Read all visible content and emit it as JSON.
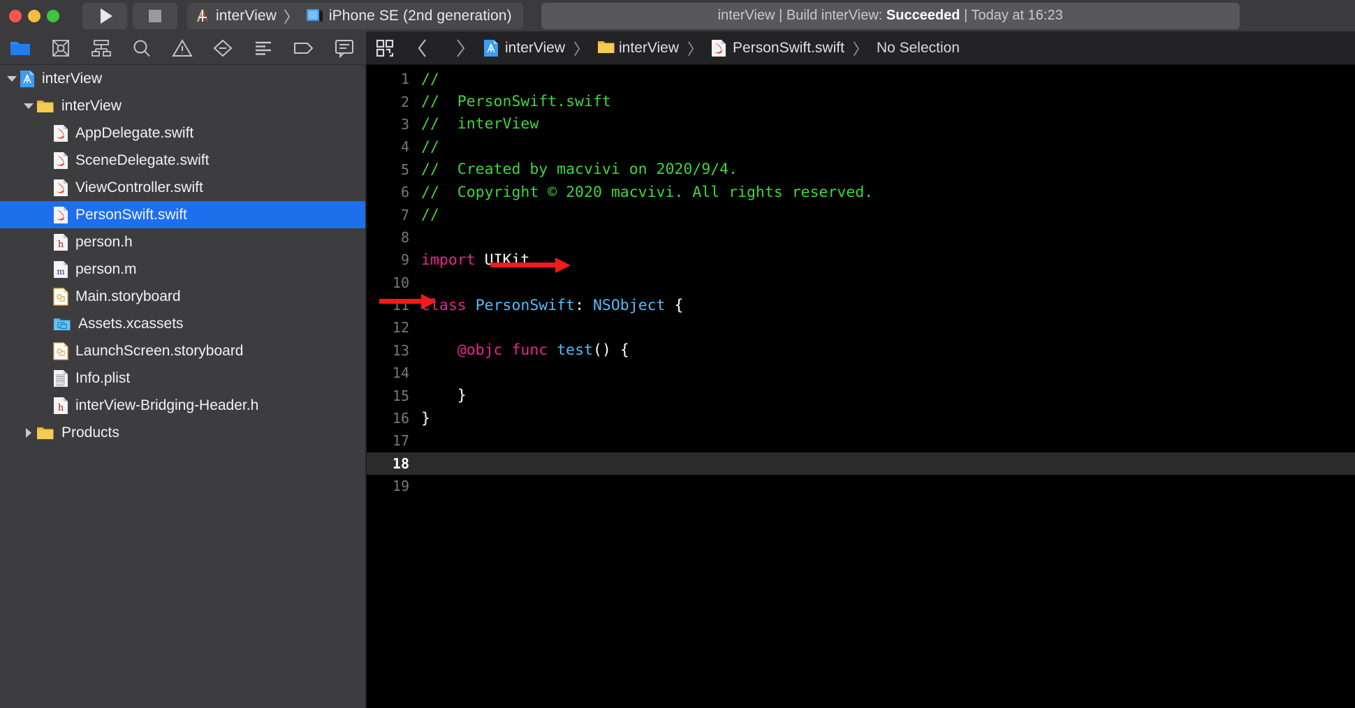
{
  "titlebar": {
    "window_controls": [
      "close",
      "minimize",
      "zoom"
    ],
    "run_button": "run-icon",
    "stop_button": "stop-icon",
    "scheme": {
      "project": "interView",
      "separator": "〉",
      "destination": "iPhone SE (2nd generation)"
    },
    "status": {
      "project": "interView",
      "sep1": "|",
      "action": "Build interView:",
      "result": "Succeeded",
      "sep2": "|",
      "time": "Today at 16:23",
      "full": "interView | Build interView: Succeeded | Today at 16:23"
    }
  },
  "navigator_toolbar": {
    "items": [
      {
        "name": "project-navigator-icon",
        "glyph": "folder",
        "active": true
      },
      {
        "name": "source-control-navigator-icon",
        "glyph": "source-control",
        "active": false
      },
      {
        "name": "symbol-navigator-icon",
        "glyph": "symbol",
        "active": false
      },
      {
        "name": "find-navigator-icon",
        "glyph": "search",
        "active": false
      },
      {
        "name": "issue-navigator-icon",
        "glyph": "warning",
        "active": false
      },
      {
        "name": "test-navigator-icon",
        "glyph": "diamond-minus",
        "active": false
      },
      {
        "name": "debug-navigator-icon",
        "glyph": "debug-lines",
        "active": false
      },
      {
        "name": "breakpoint-navigator-icon",
        "glyph": "tag",
        "active": false
      },
      {
        "name": "report-navigator-icon",
        "glyph": "speech-bubble",
        "active": false
      }
    ]
  },
  "editor_toolbar": {
    "related_items_icon": "grid-squares-icon",
    "back_icon": "‹",
    "forward_icon": "›",
    "breadcrumb": [
      {
        "label": "interView",
        "icon": "xcode-project-icon"
      },
      {
        "label": "interView",
        "icon": "folder-icon"
      },
      {
        "label": "PersonSwift.swift",
        "icon": "swift-file-icon"
      },
      {
        "label": "No Selection",
        "icon": "none"
      }
    ],
    "separator": "〉"
  },
  "navigator": {
    "rows": [
      {
        "label": "interView",
        "icon": "xcode-project-icon",
        "indent": 0,
        "disclosure": "down",
        "selected": false
      },
      {
        "label": "interView",
        "icon": "folder-icon",
        "indent": 1,
        "disclosure": "down",
        "selected": false
      },
      {
        "label": "AppDelegate.swift",
        "icon": "swift-file-icon",
        "indent": 2,
        "disclosure": "none",
        "selected": false
      },
      {
        "label": "SceneDelegate.swift",
        "icon": "swift-file-icon",
        "indent": 2,
        "disclosure": "none",
        "selected": false
      },
      {
        "label": "ViewController.swift",
        "icon": "swift-file-icon",
        "indent": 2,
        "disclosure": "none",
        "selected": false
      },
      {
        "label": "PersonSwift.swift",
        "icon": "swift-file-icon",
        "indent": 2,
        "disclosure": "none",
        "selected": true
      },
      {
        "label": "person.h",
        "icon": "header-file-icon",
        "indent": 2,
        "disclosure": "none",
        "selected": false
      },
      {
        "label": "person.m",
        "icon": "objc-file-icon",
        "indent": 2,
        "disclosure": "none",
        "selected": false
      },
      {
        "label": "Main.storyboard",
        "icon": "storyboard-file-icon",
        "indent": 2,
        "disclosure": "none",
        "selected": false
      },
      {
        "label": "Assets.xcassets",
        "icon": "assets-folder-icon",
        "indent": 2,
        "disclosure": "none",
        "selected": false
      },
      {
        "label": "LaunchScreen.storyboard",
        "icon": "storyboard-file-icon",
        "indent": 2,
        "disclosure": "none",
        "selected": false
      },
      {
        "label": "Info.plist",
        "icon": "plist-file-icon",
        "indent": 2,
        "disclosure": "none",
        "selected": false
      },
      {
        "label": "interView-Bridging-Header.h",
        "icon": "header-file-icon",
        "indent": 2,
        "disclosure": "none",
        "selected": false
      },
      {
        "label": "Products",
        "icon": "folder-icon",
        "indent": 1,
        "disclosure": "right",
        "selected": false
      }
    ]
  },
  "editor": {
    "current_line": 18,
    "total_lines": 19,
    "lines": [
      {
        "n": "1",
        "tokens": [
          {
            "t": "//",
            "c": "comment"
          }
        ]
      },
      {
        "n": "2",
        "tokens": [
          {
            "t": "//  PersonSwift.swift",
            "c": "comment"
          }
        ]
      },
      {
        "n": "3",
        "tokens": [
          {
            "t": "//  interView",
            "c": "comment"
          }
        ]
      },
      {
        "n": "4",
        "tokens": [
          {
            "t": "//",
            "c": "comment"
          }
        ]
      },
      {
        "n": "5",
        "tokens": [
          {
            "t": "//  Created by macvivi on 2020/9/4.",
            "c": "comment"
          }
        ]
      },
      {
        "n": "6",
        "tokens": [
          {
            "t": "//  Copyright © 2020 macvivi. All rights reserved.",
            "c": "comment"
          }
        ]
      },
      {
        "n": "7",
        "tokens": [
          {
            "t": "//",
            "c": "comment"
          }
        ]
      },
      {
        "n": "8",
        "tokens": []
      },
      {
        "n": "9",
        "tokens": [
          {
            "t": "import",
            "c": "kw"
          },
          {
            "t": " ",
            "c": "plain"
          },
          {
            "t": "UIKit",
            "c": "plain"
          }
        ]
      },
      {
        "n": "10",
        "tokens": []
      },
      {
        "n": "11",
        "tokens": [
          {
            "t": "class",
            "c": "kw"
          },
          {
            "t": " ",
            "c": "plain"
          },
          {
            "t": "PersonSwift",
            "c": "type"
          },
          {
            "t": ": ",
            "c": "plain"
          },
          {
            "t": "NSObject",
            "c": "type"
          },
          {
            "t": " {",
            "c": "plain"
          }
        ]
      },
      {
        "n": "12",
        "tokens": []
      },
      {
        "n": "13",
        "tokens": [
          {
            "t": "    ",
            "c": "plain"
          },
          {
            "t": "@objc",
            "c": "attr"
          },
          {
            "t": " ",
            "c": "plain"
          },
          {
            "t": "func",
            "c": "kw"
          },
          {
            "t": " ",
            "c": "plain"
          },
          {
            "t": "test",
            "c": "type"
          },
          {
            "t": "() {",
            "c": "plain"
          }
        ]
      },
      {
        "n": "14",
        "tokens": []
      },
      {
        "n": "15",
        "tokens": [
          {
            "t": "    }",
            "c": "plain"
          }
        ]
      },
      {
        "n": "16",
        "tokens": [
          {
            "t": "}",
            "c": "plain"
          }
        ]
      },
      {
        "n": "17",
        "tokens": []
      },
      {
        "n": "18",
        "tokens": []
      },
      {
        "n": "19",
        "tokens": []
      }
    ],
    "annotations": [
      {
        "name": "red-arrow-nsobject",
        "target_line": 11,
        "color": "#f01b1b"
      },
      {
        "name": "red-arrow-objc",
        "target_line": 13,
        "color": "#f01b1b"
      }
    ]
  },
  "colors": {
    "selection_blue": "#1f6fec",
    "comment_green": "#3ed63e",
    "keyword_pink": "#e8268f",
    "type_blue": "#52bdf7",
    "annotation_red": "#f01b1b",
    "editor_bg": "#000000",
    "navigator_bg": "#3d3d40",
    "titlebar_bg": "#3b3b3d"
  }
}
